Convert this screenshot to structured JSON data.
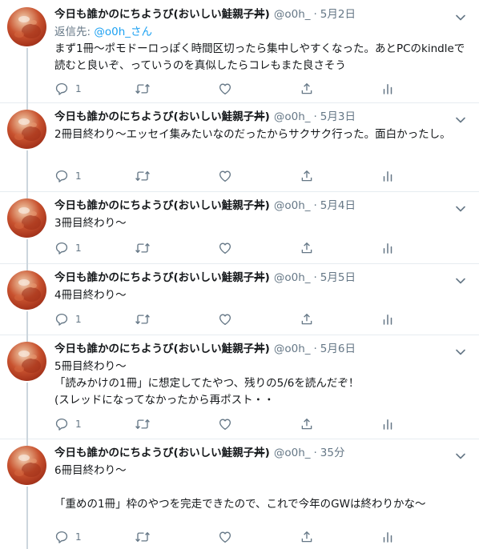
{
  "author": {
    "display_name_main": "今日も誰かのにちようび(おいしい鮭親子",
    "display_name_strike": "丼",
    "display_name_close": ")",
    "handle": "@o0h_",
    "separator": "·"
  },
  "reply": {
    "prefix": "返信先:",
    "target": "@o0h_さん"
  },
  "tweets": [
    {
      "time": "5月2日",
      "text": "まず1冊〜ポモドーロっぽく時間区切ったら集中しやすくなった。あとPCのkindleで読むと良いぞ、っていうのを真似したらコレもまた良さそう",
      "reply_count": "1"
    },
    {
      "time": "5月3日",
      "text": "2冊目終わり〜エッセイ集みたいなのだったからサクサク行った。面白かったし。",
      "reply_count": "1"
    },
    {
      "time": "5月4日",
      "text": "3冊目終わり〜",
      "reply_count": "1"
    },
    {
      "time": "5月5日",
      "text": "4冊目終わり〜",
      "reply_count": "1"
    },
    {
      "time": "5月6日",
      "text": "5冊目終わり〜\n「読みかけの1冊」に想定してたやつ、残りの5/6を読んだぞ！\n(スレッドになってなかったから再ポスト・・",
      "reply_count": "1"
    },
    {
      "time": "35分",
      "text": "6冊目終わり〜\n\n「重めの1冊」枠のやつを完走できたので、これで今年のGWは終わりかな〜",
      "reply_count": "1"
    }
  ],
  "icons": {
    "reply": "reply-icon",
    "retweet": "retweet-icon",
    "like": "heart-icon",
    "share": "share-icon",
    "analytics": "analytics-icon",
    "caret": "chevron-down-icon"
  },
  "colors": {
    "text": "#14171a",
    "secondary": "#657786",
    "link": "#1da1f2",
    "divider": "#e6ecf0",
    "thread_line": "#ccd6dd"
  }
}
